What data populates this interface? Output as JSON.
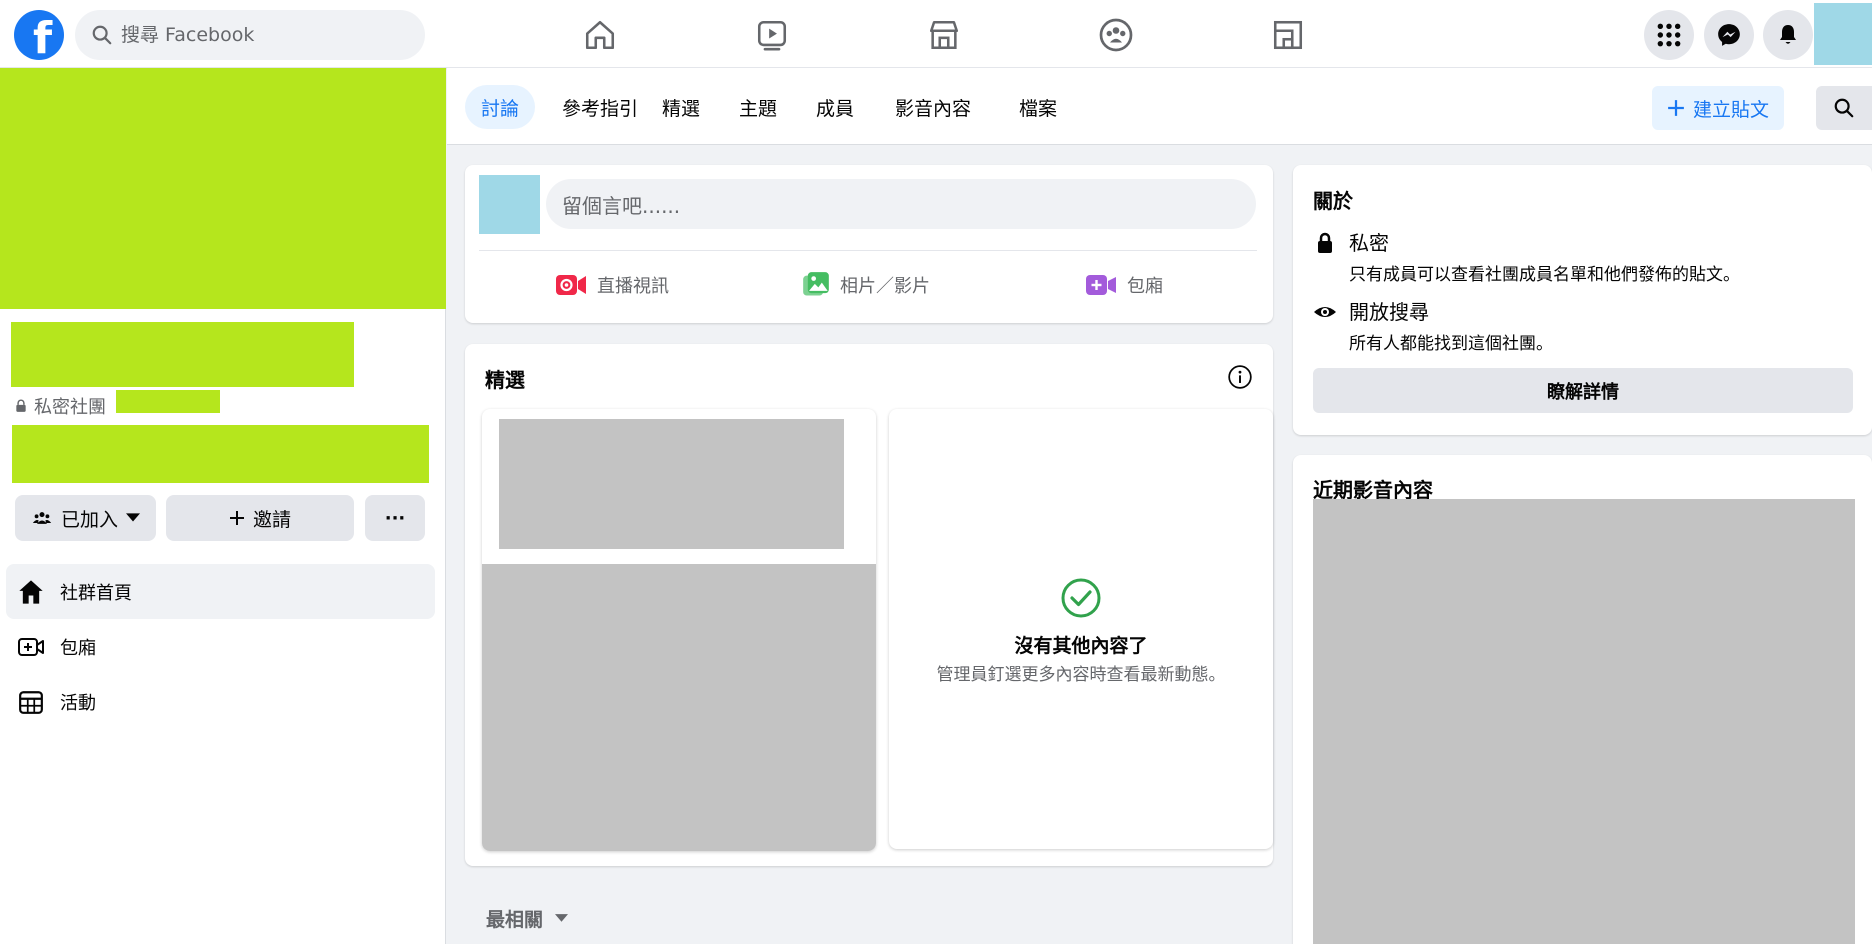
{
  "topbar": {
    "logo_letter": "f",
    "search_placeholder": "搜尋 Facebook"
  },
  "group": {
    "privacy_label": "私密社團",
    "joined_label": "已加入",
    "invite_label": "邀請",
    "more_label": "···"
  },
  "sidebar": {
    "items": [
      {
        "label": "社群首頁",
        "icon": "home-icon"
      },
      {
        "label": "包廂",
        "icon": "room-icon"
      },
      {
        "label": "活動",
        "icon": "calendar-icon"
      }
    ]
  },
  "tabs": [
    {
      "label": "討論",
      "active": true
    },
    {
      "label": "參考指引"
    },
    {
      "label": "精選"
    },
    {
      "label": "主題"
    },
    {
      "label": "成員"
    },
    {
      "label": "影音內容"
    },
    {
      "label": "檔案"
    }
  ],
  "create_post_label": "建立貼文",
  "composer": {
    "placeholder": "留個言吧......",
    "actions": [
      {
        "label": "直播視訊",
        "icon": "live-video-icon",
        "color": "#f02849"
      },
      {
        "label": "相片／影片",
        "icon": "photo-icon",
        "color": "#45bd62"
      },
      {
        "label": "包廂",
        "icon": "room-video-icon",
        "color": "#a35bdb"
      }
    ]
  },
  "featured": {
    "title": "精選",
    "empty_title": "沒有其他內容了",
    "empty_desc": "管理員釘選更多內容時查看最新動態。"
  },
  "sort_label": "最相關",
  "about": {
    "title": "關於",
    "private_title": "私密",
    "private_desc": "只有成員可以查看社團成員名單和他們發佈的貼文。",
    "visible_title": "開放搜尋",
    "visible_desc": "所有人都能找到這個社團。",
    "learn_more": "瞭解詳情"
  },
  "recent_media": {
    "title": "近期影音內容"
  },
  "colors": {
    "brand": "#1877f2",
    "highlight": "#b5e61d",
    "avatar": "#9fd8e7",
    "success": "#31a24c"
  }
}
